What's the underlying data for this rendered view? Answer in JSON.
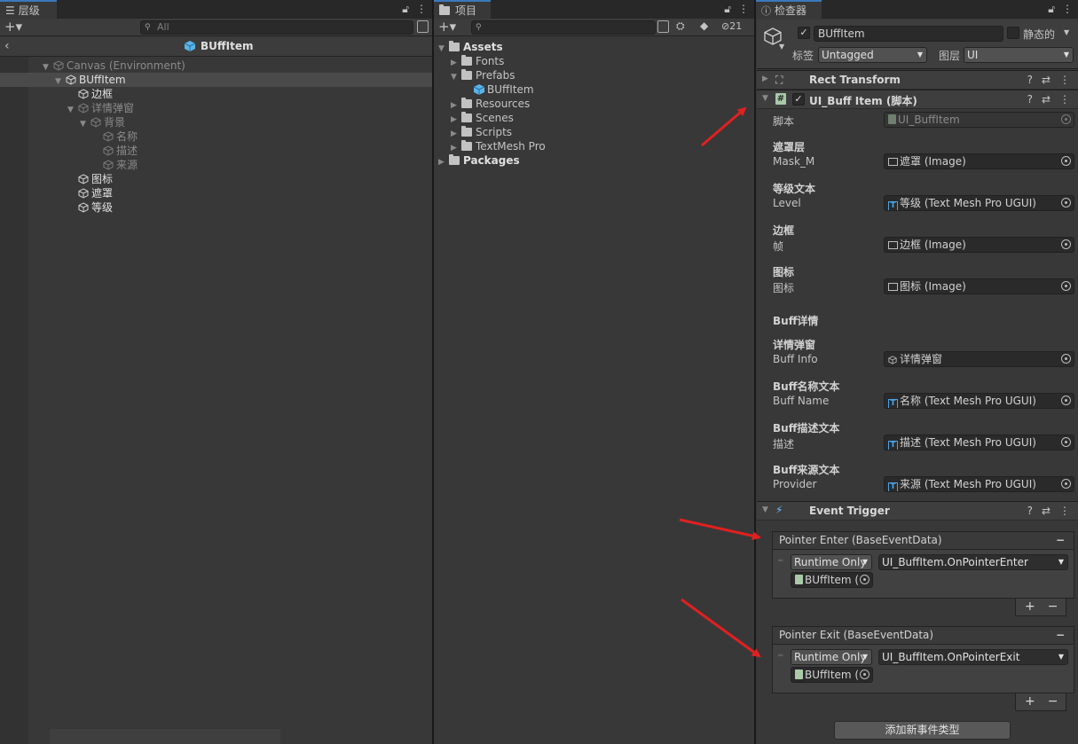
{
  "hierarchy": {
    "tab_label": "层级",
    "search_placeholder": "All",
    "breadcrumb": "BUffItem",
    "items": [
      {
        "label": "Canvas (Environment)"
      },
      {
        "label": "BUffItem"
      },
      {
        "label": "边框"
      },
      {
        "label": "详情弹窗"
      },
      {
        "label": "背景"
      },
      {
        "label": "名称"
      },
      {
        "label": "描述"
      },
      {
        "label": "来源"
      },
      {
        "label": "图标"
      },
      {
        "label": "遮罩"
      },
      {
        "label": "等级"
      }
    ]
  },
  "project": {
    "tab_label": "项目",
    "hidden_count": "21",
    "items": [
      {
        "label": "Assets"
      },
      {
        "label": "Fonts"
      },
      {
        "label": "Prefabs"
      },
      {
        "label": "BUffItem"
      },
      {
        "label": "Resources"
      },
      {
        "label": "Scenes"
      },
      {
        "label": "Scripts"
      },
      {
        "label": "TextMesh Pro"
      },
      {
        "label": "Packages"
      }
    ]
  },
  "inspector": {
    "tab_label": "检查器",
    "object_name": "BUffItem",
    "static_label": "静态的",
    "tag_label": "标签",
    "tag_value": "Untagged",
    "layer_label": "图层",
    "layer_value": "UI",
    "rect_transform": "Rect Transform",
    "script_component": "UI_Buff Item",
    "script_suffix": "(脚本)",
    "script_label": "脚本",
    "script_value": "UI_BuffItem",
    "fields": [
      {
        "header": "遮罩层",
        "label": "Mask_M",
        "value": "遮罩 (Image)"
      },
      {
        "header": "等级文本",
        "label": "Level",
        "value": "等级 (Text Mesh Pro UGUI)"
      },
      {
        "header": "边框",
        "label": "帧",
        "value": "边框 (Image)"
      },
      {
        "header": "图标",
        "label": "图标",
        "value": "图标 (Image)"
      }
    ],
    "section_buff": "Buff详情",
    "fields2": [
      {
        "header": "详情弹窗",
        "label": "Buff Info",
        "value": "详情弹窗"
      },
      {
        "header": "Buff名称文本",
        "label": "Buff Name",
        "value": "名称 (Text Mesh Pro UGUI)"
      },
      {
        "header": "Buff描述文本",
        "label": "描述",
        "value": "描述 (Text Mesh Pro UGUI)"
      },
      {
        "header": "Buff来源文本",
        "label": "Provider",
        "value": "来源 (Text Mesh Pro UGUI)"
      }
    ],
    "event_trigger": "Event Trigger",
    "events": [
      {
        "title": "Pointer Enter (BaseEventData)",
        "mode": "Runtime Only",
        "function": "UI_BuffItem.OnPointerEnter",
        "object": "BUffItem ("
      },
      {
        "title": "Pointer Exit (BaseEventData)",
        "mode": "Runtime Only",
        "function": "UI_BuffItem.OnPointerExit",
        "object": "BUffItem ("
      }
    ],
    "add_event_button": "添加新事件类型"
  },
  "colors": {
    "accent_tab": "#3a79bb",
    "arrow_red": "#e02020",
    "prefab_blue": "#5ab4e8"
  }
}
